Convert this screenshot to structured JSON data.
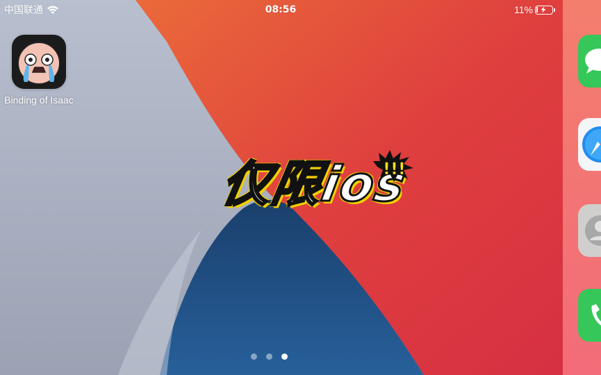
{
  "status_bar": {
    "carrier": "中国联通",
    "time": "08:56",
    "battery": "11%"
  },
  "apps": [
    {
      "label": "Binding of Isaac",
      "icon": "isaac-crying-face-icon"
    }
  ],
  "dock": [
    {
      "icon": "messages-icon",
      "color": "#35c759"
    },
    {
      "icon": "safari-icon",
      "color": "#2a8cf0"
    },
    {
      "icon": "contacts-icon",
      "color": "#c8c8c8"
    },
    {
      "icon": "phone-icon",
      "color": "#35c759"
    }
  ],
  "overlay": {
    "text": "仅限ios",
    "exclaim": "!!!"
  },
  "page_indicator": {
    "pages": 3,
    "current": 3
  },
  "colors": {
    "wallpaper_gray": "#aeb6c8",
    "wallpaper_orange": "#e0523a",
    "wallpaper_red": "#d8373f",
    "wallpaper_blue": "#1f4f80",
    "dock_pink": "#f77c84"
  }
}
